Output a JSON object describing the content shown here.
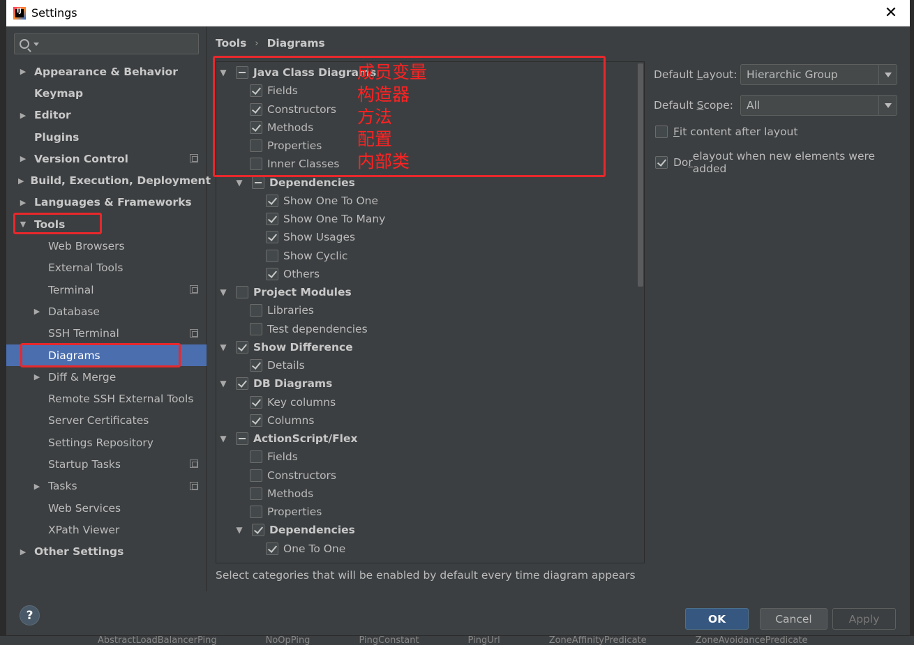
{
  "window": {
    "title": "Settings"
  },
  "search": {
    "placeholder": ""
  },
  "sidebar": {
    "items": [
      {
        "label": "Appearance & Behavior"
      },
      {
        "label": "Keymap"
      },
      {
        "label": "Editor"
      },
      {
        "label": "Plugins"
      },
      {
        "label": "Version Control"
      },
      {
        "label": "Build, Execution, Deployment"
      },
      {
        "label": "Languages & Frameworks"
      },
      {
        "label": "Tools"
      },
      {
        "label": "Web Browsers"
      },
      {
        "label": "External Tools"
      },
      {
        "label": "Terminal"
      },
      {
        "label": "Database"
      },
      {
        "label": "SSH Terminal"
      },
      {
        "label": "Diagrams"
      },
      {
        "label": "Diff & Merge"
      },
      {
        "label": "Remote SSH External Tools"
      },
      {
        "label": "Server Certificates"
      },
      {
        "label": "Settings Repository"
      },
      {
        "label": "Startup Tasks"
      },
      {
        "label": "Tasks"
      },
      {
        "label": "Web Services"
      },
      {
        "label": "XPath Viewer"
      },
      {
        "label": "Other Settings"
      }
    ]
  },
  "breadcrumb": {
    "parent": "Tools",
    "separator": "›",
    "current": "Diagrams"
  },
  "categories": [
    {
      "label": "Java Class Diagrams",
      "state": "partial"
    },
    {
      "label": "Fields",
      "state": "checked"
    },
    {
      "label": "Constructors",
      "state": "checked"
    },
    {
      "label": "Methods",
      "state": "checked"
    },
    {
      "label": "Properties",
      "state": "unchecked"
    },
    {
      "label": "Inner Classes",
      "state": "unchecked"
    },
    {
      "label": "Dependencies",
      "state": "partial"
    },
    {
      "label": "Show One To One",
      "state": "checked"
    },
    {
      "label": "Show One To Many",
      "state": "checked"
    },
    {
      "label": "Show Usages",
      "state": "checked"
    },
    {
      "label": "Show Cyclic",
      "state": "unchecked"
    },
    {
      "label": "Others",
      "state": "checked"
    },
    {
      "label": "Project Modules",
      "state": "unchecked"
    },
    {
      "label": "Libraries",
      "state": "unchecked"
    },
    {
      "label": "Test dependencies",
      "state": "unchecked"
    },
    {
      "label": "Show Difference",
      "state": "checked"
    },
    {
      "label": "Details",
      "state": "checked"
    },
    {
      "label": "DB Diagrams",
      "state": "checked"
    },
    {
      "label": "Key columns",
      "state": "checked"
    },
    {
      "label": "Columns",
      "state": "checked"
    },
    {
      "label": "ActionScript/Flex",
      "state": "partial"
    },
    {
      "label": "Fields",
      "state": "unchecked"
    },
    {
      "label": "Constructors",
      "state": "unchecked"
    },
    {
      "label": "Methods",
      "state": "unchecked"
    },
    {
      "label": "Properties",
      "state": "unchecked"
    },
    {
      "label": "Dependencies",
      "state": "checked"
    },
    {
      "label": "One To One",
      "state": "checked"
    }
  ],
  "annotations": {
    "fields": "成员变量",
    "constructors": "构造器",
    "methods": "方法",
    "properties": "配置",
    "inner_classes": "内部类"
  },
  "note": "Select categories that will be enabled by default every time diagram appears",
  "options": {
    "layout_label_pre": "Default ",
    "layout_label_u": "L",
    "layout_label_post": "ayout:",
    "layout_value": "Hierarchic Group",
    "scope_label_pre": "Default ",
    "scope_label_u": "S",
    "scope_label_post": "cope:",
    "scope_value": "All",
    "fit_u": "F",
    "fit_rest": "it content after layout",
    "fit_checked": false,
    "relayout_pre": "Do ",
    "relayout_u": "r",
    "relayout_post": "elayout when new elements were added",
    "relayout_checked": true
  },
  "buttons": {
    "help": "?",
    "ok": "OK",
    "cancel": "Cancel",
    "apply": "Apply"
  },
  "taskbar": [
    "AbstractLoadBalancerPing",
    "NoOpPing",
    "PingConstant",
    "PingUrl",
    "ZoneAffinityPredicate",
    "ZoneAvoidancePredicate"
  ]
}
